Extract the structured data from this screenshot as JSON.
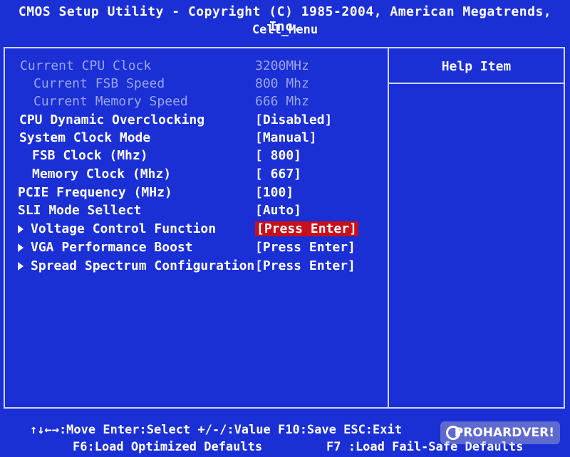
{
  "header": {
    "title": "CMOS Setup Utility - Copyright (C) 1985-2004, American Megatrends, Inc.",
    "menu_name": "Cell_Menu"
  },
  "settings": [
    {
      "label": "Current CPU Clock",
      "value": "3200MHz"
    },
    {
      "label": "Current FSB Speed",
      "value": "800 Mhz"
    },
    {
      "label": "Current Memory Speed",
      "value": "666 Mhz"
    },
    {
      "label": "CPU Dynamic Overclocking",
      "value": "[Disabled]"
    },
    {
      "label": "System Clock Mode",
      "value": "[Manual]"
    },
    {
      "label": "FSB Clock (Mhz)",
      "value": "[ 800]"
    },
    {
      "label": "Memory Clock (Mhz)",
      "value": "[ 667]"
    },
    {
      "label": "PCIE Frequency (MHz)",
      "value": "[100]"
    },
    {
      "label": "SLI Mode Sellect",
      "value": "[Auto]"
    },
    {
      "label": "Voltage Control Function",
      "value": "[Press Enter]"
    },
    {
      "label": "VGA Performance Boost",
      "value": "[Press Enter]"
    },
    {
      "label": "Spread Spectrum Configuration",
      "value": "[Press Enter]"
    }
  ],
  "help": {
    "title": "Help Item"
  },
  "footer": {
    "line1": "↑↓←→:Move  Enter:Select  +/-/:Value  F10:Save  ESC:Exit",
    "line2_left": "F6:Load Optimized Defaults",
    "line2_right": "F7 :Load Fail-Safe Defaults"
  },
  "watermark": {
    "text": "PROHARDVER!"
  },
  "colors": {
    "background": "#1a2fd4",
    "selection": "#c8101c",
    "disabled_text": "#9aa6e6"
  }
}
